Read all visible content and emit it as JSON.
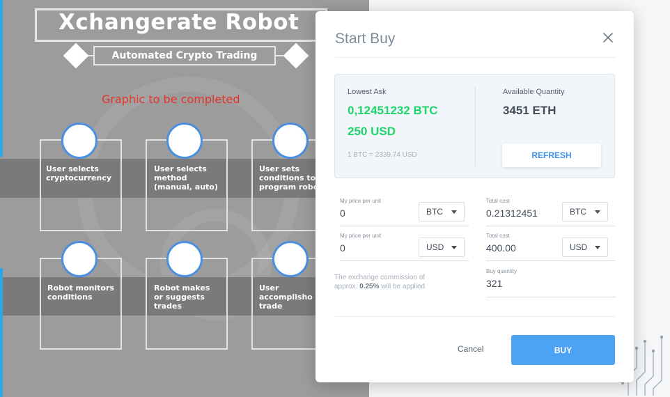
{
  "background": {
    "title": "Xchangerate Robot",
    "subtitle": "Automated Crypto Trading",
    "note": "Graphic to be completed",
    "steps": [
      [
        "User selects",
        "cryptocurrency"
      ],
      [
        "User selects",
        "method",
        "(manual, auto)"
      ],
      [
        "User sets",
        "conditions to",
        "program robo"
      ],
      [
        "Robot monitors",
        "conditions"
      ],
      [
        "Robot makes",
        "or suggests",
        "trades"
      ],
      [
        "User",
        "accomplisho",
        "trade"
      ]
    ],
    "colors": {
      "panel": "#9c9c9c",
      "band": "#7a7a7a",
      "note": "#e8322c",
      "circle_border": "#4a8fe0"
    }
  },
  "modal": {
    "title": "Start Buy",
    "close_icon": "close-icon",
    "lowest_ask": {
      "label": "Lowest Ask",
      "btc_value": "0,12451232 BTC",
      "usd_value": "250 USD",
      "rate": "1 BTC = 2339.74 USD"
    },
    "available": {
      "label": "Available Quantity",
      "value": "3451 ETH"
    },
    "refresh_label": "REFRESH",
    "fields": {
      "price_btc": {
        "label": "My price per unit",
        "value": "0",
        "currency": "BTC"
      },
      "total_btc": {
        "label": "Total cost",
        "value": "0.21312451",
        "currency": "BTC"
      },
      "price_usd": {
        "label": "My price per unit",
        "value": "0",
        "currency": "USD"
      },
      "total_usd": {
        "label": "Total cost",
        "value": "400.00",
        "currency": "USD"
      },
      "buy_quantity": {
        "label": "Buy quantity",
        "value": "321"
      }
    },
    "commission": {
      "before": "The exchange commission of approx.",
      "percent": "0.25%",
      "after": "will be applied"
    },
    "cancel_label": "Cancel",
    "buy_label": "BUY",
    "colors": {
      "accent": "#4da3f3",
      "positive": "#1fd46b",
      "link": "#3d8fe8"
    }
  }
}
